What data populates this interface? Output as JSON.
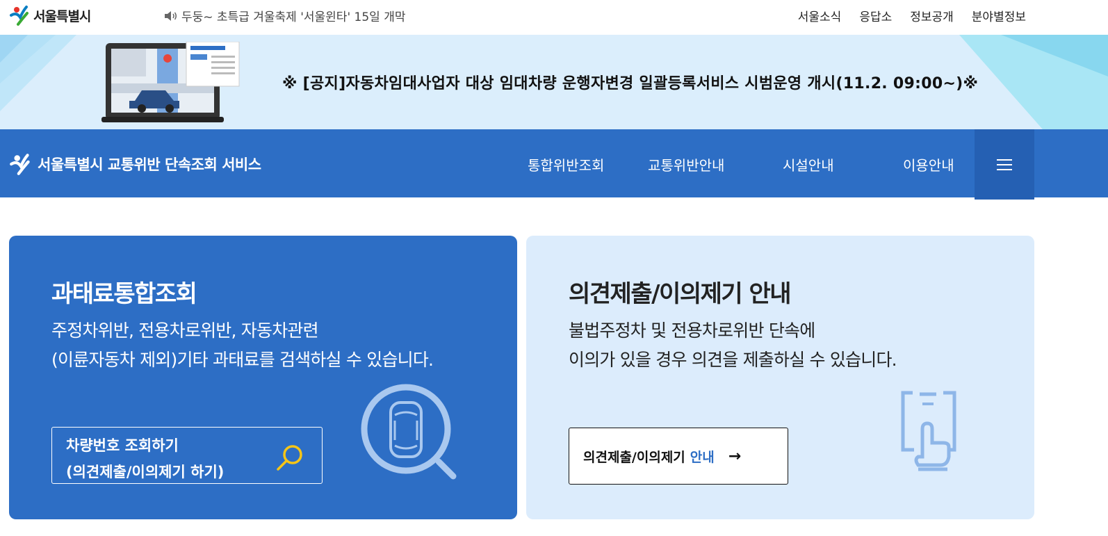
{
  "top": {
    "logo_text": "서울특별시",
    "notice": "두둥~ 초특급 겨울축제 '서울윈타' 15일 개막",
    "util_links": [
      "서울소식",
      "응답소",
      "정보공개",
      "분야별정보"
    ]
  },
  "banner": {
    "text": "※ [공지]자동차임대사업자 대상 임대차량 운행자변경 일괄등록서비스 시범운영 개시(11.2. 09:00~)※"
  },
  "nav": {
    "brand": "서울특별시 교통위반 단속조회 서비스",
    "items": [
      "통합위반조회",
      "교통위반안내",
      "시설안내",
      "이용안내"
    ]
  },
  "card_left": {
    "title": "과태료통합조회",
    "desc_line1": "주정차위반, 전용차로위반, 자동차관련",
    "desc_line2": "(이륜자동차 제외)기타 과태료를 검색하실 수 있습니다.",
    "button_line1": "차량번호 조회하기",
    "button_line2": "(의견제출/이의제기 하기)"
  },
  "card_right": {
    "title": "의견제출/이의제기 안내",
    "desc_line1": "불법주정차 및 전용차로위반 단속에",
    "desc_line2": "이의가 있을 경우 의견을 제출하실 수 있습니다.",
    "button_text": "의견제출/이의제기",
    "button_highlight": "안내",
    "button_arrow": "→"
  },
  "colors": {
    "primary_blue": "#2d6ec5",
    "dark_blue": "#2560b3",
    "light_blue": "#dcecfc",
    "search_yellow": "#f5c518"
  },
  "icons": [
    "seoul-logo-icon",
    "speaker-icon",
    "menu-icon",
    "search-icon",
    "magnifier-car-icon",
    "clipboard-hand-icon",
    "car-map-illustration"
  ]
}
